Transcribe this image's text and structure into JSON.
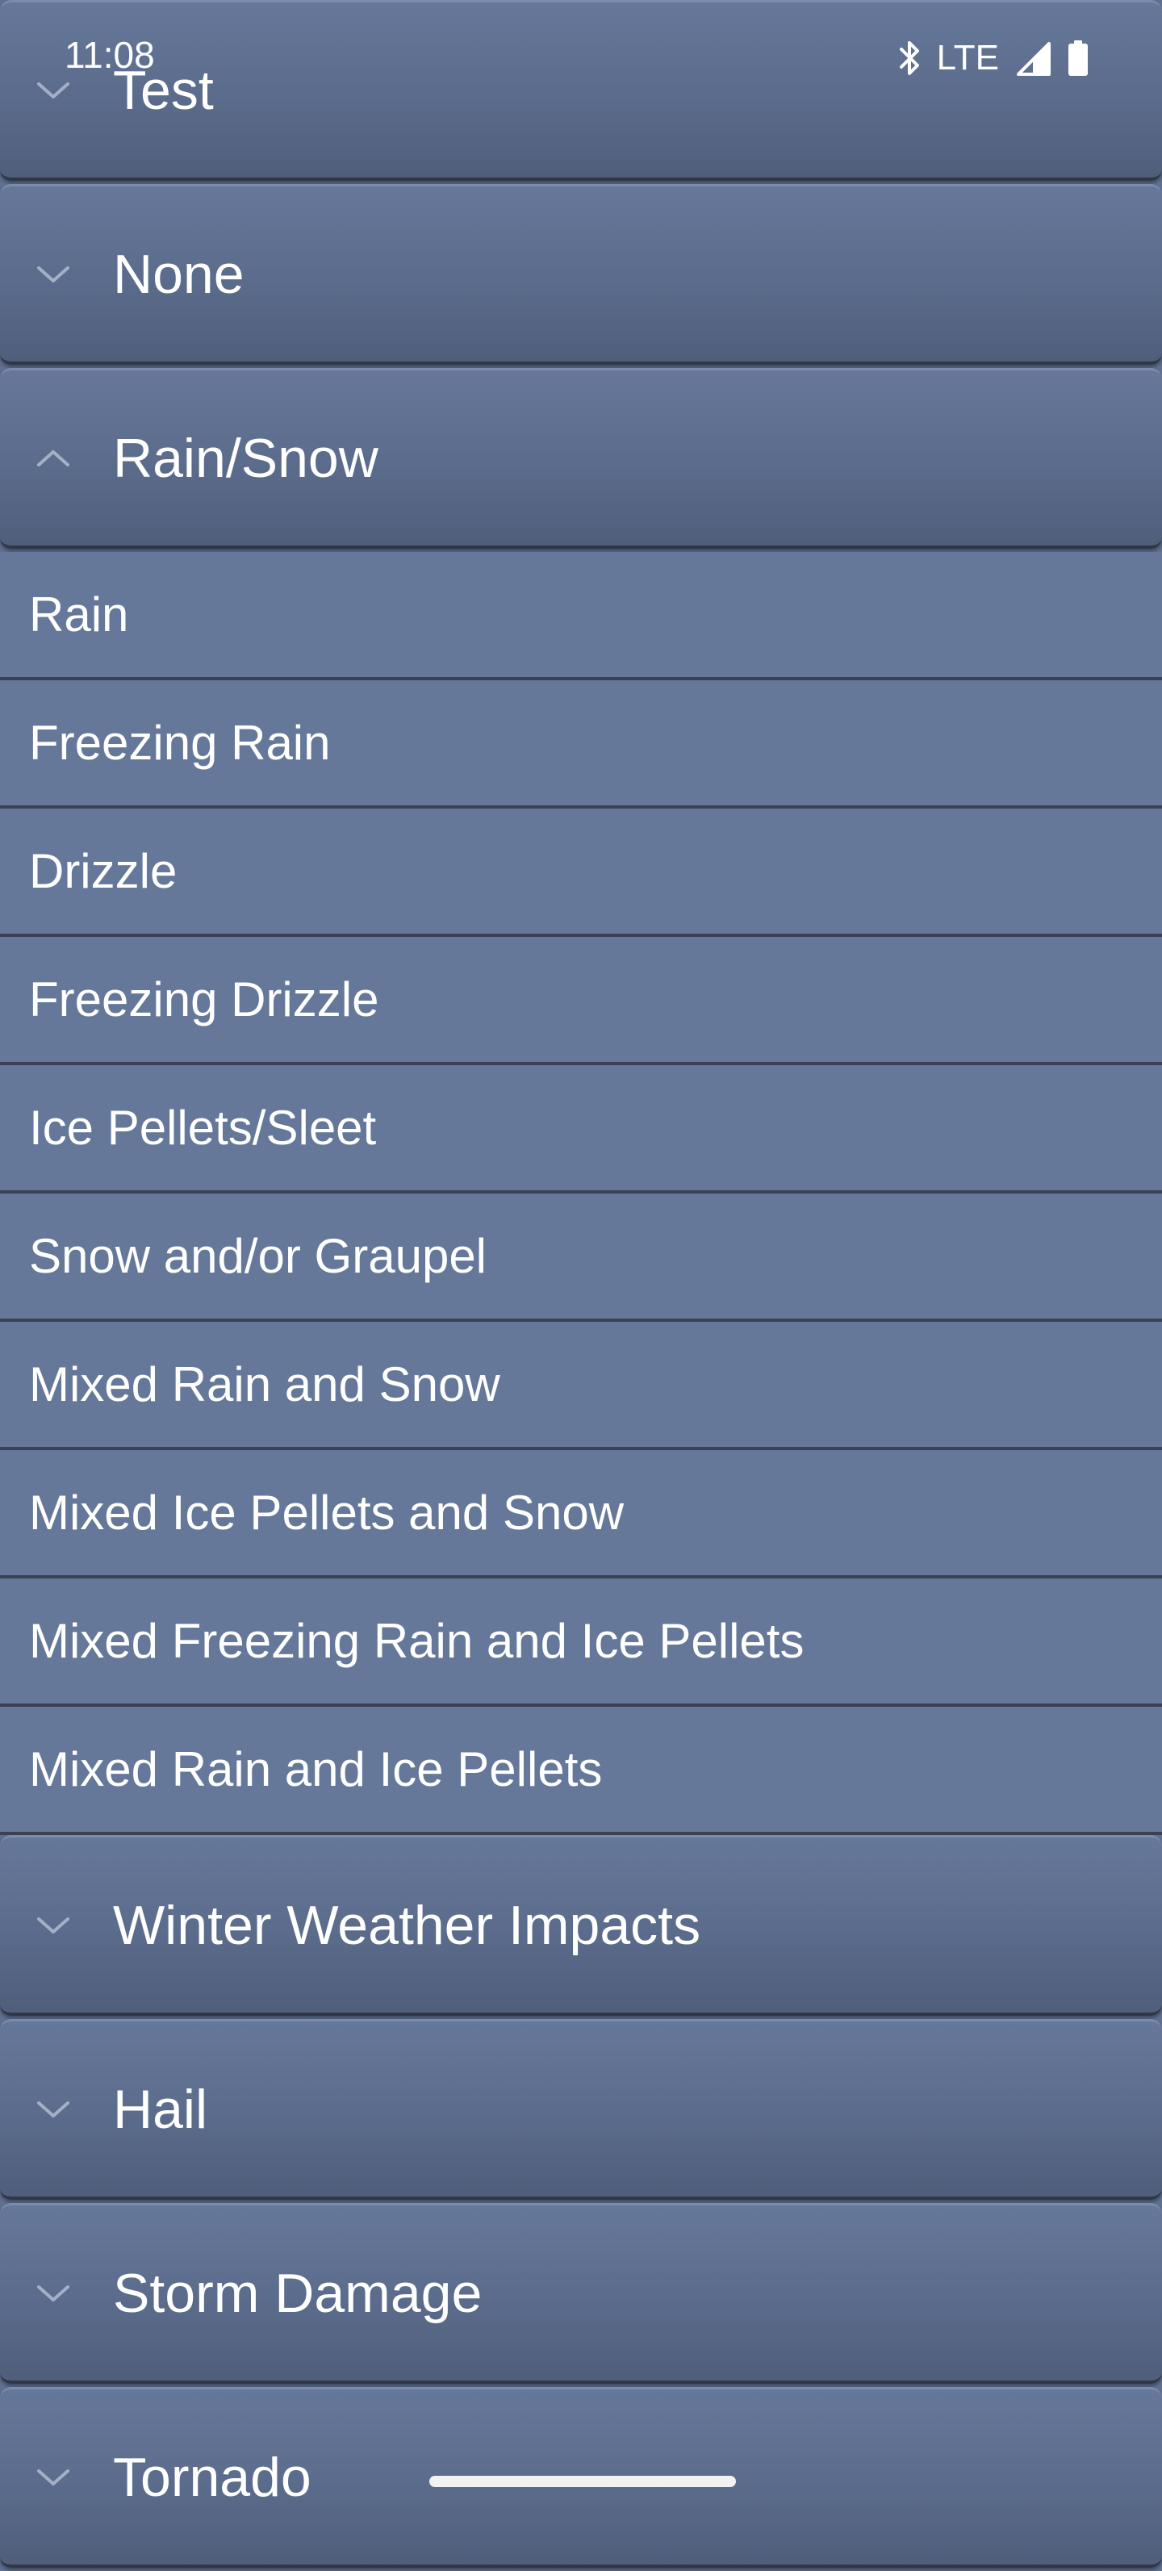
{
  "status_bar": {
    "time": "11:08",
    "network": "LTE",
    "icons": [
      "bluetooth-icon",
      "signal-icon",
      "battery-icon"
    ]
  },
  "groups": [
    {
      "title": "Test",
      "expanded": false,
      "icon": "chevron-down-icon"
    },
    {
      "title": "None",
      "expanded": false,
      "icon": "chevron-down-icon"
    },
    {
      "title": "Rain/Snow",
      "expanded": true,
      "icon": "chevron-up-icon",
      "items": [
        "Rain",
        "Freezing Rain",
        "Drizzle",
        "Freezing Drizzle",
        "Ice Pellets/Sleet",
        "Snow and/or Graupel",
        "Mixed Rain and Snow",
        "Mixed Ice Pellets and Snow",
        "Mixed Freezing Rain and Ice Pellets",
        "Mixed Rain and Ice Pellets"
      ]
    },
    {
      "title": "Winter Weather Impacts",
      "expanded": false,
      "icon": "chevron-down-icon"
    },
    {
      "title": "Hail",
      "expanded": false,
      "icon": "chevron-down-icon"
    },
    {
      "title": "Storm Damage",
      "expanded": false,
      "icon": "chevron-down-icon"
    },
    {
      "title": "Tornado",
      "expanded": false,
      "icon": "chevron-down-icon"
    }
  ],
  "colors": {
    "background": "#5f7091",
    "header_top": "#66789a",
    "header_bottom": "#4f5e7b",
    "item_background": "#65789a",
    "divider": "#3a4152",
    "text": "#ffffff",
    "chevron": "#a4b0c6"
  }
}
